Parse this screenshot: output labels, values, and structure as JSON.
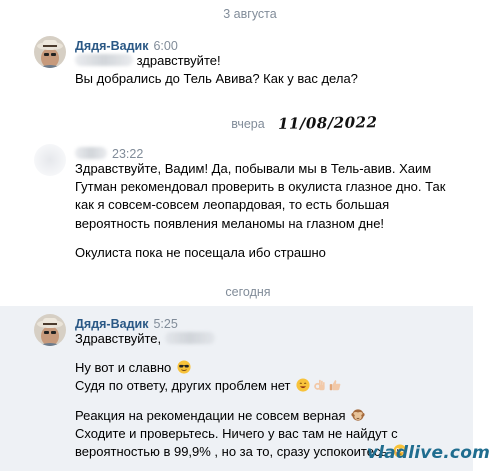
{
  "dates": {
    "aug3": "3 августа",
    "yesterday": "вчера",
    "yesterday_handwritten": "11/08/2022",
    "today": "сегодня"
  },
  "messages": [
    {
      "author": "Дядя-Вадик",
      "time": "6:00",
      "lines": [
        "здравствуйте!",
        "Вы добрались до Тель Авива? Как у вас дела?"
      ]
    },
    {
      "author": "",
      "time": "23:22",
      "lines": [
        "Здравствуйте, Вадим! Да, побывали мы в Тель-авив. Хаим",
        "Гутман рекомендовал проверить в окулиста глазное дно. Так",
        "как я совсем-совсем леопардовая, то есть большая",
        "вероятность появления меланомы на глазном дне!",
        "",
        "Окулиста пока не посещала ибо страшно"
      ]
    },
    {
      "author": "Дядя-Вадик",
      "time": "5:25",
      "lines": [
        "Здравствуйте,",
        "",
        "Ну вот и славно",
        "Судя по ответу, других проблем нет",
        "",
        "Реакция на рекомендации не совсем верная",
        "Сходите и проверьтесь. Ничего у вас там не найдут с",
        "вероятностью в 99,9% , но за то, сразу успокоитесь"
      ]
    }
  ],
  "emojis": {
    "sunglasses": "sunglasses-emoji",
    "smile": "smile-emoji",
    "ok_hand": "ok-hand-emoji",
    "thumbs_up": "thumbs-up-emoji",
    "see_no_evil": "see-no-evil-monkey-emoji",
    "flushed": "flushed-face-emoji"
  },
  "watermark": "vladlive.com",
  "colors": {
    "author_link": "#2a5885",
    "secondary_text": "#818c99",
    "highlight_bg": "#eef1f5"
  }
}
